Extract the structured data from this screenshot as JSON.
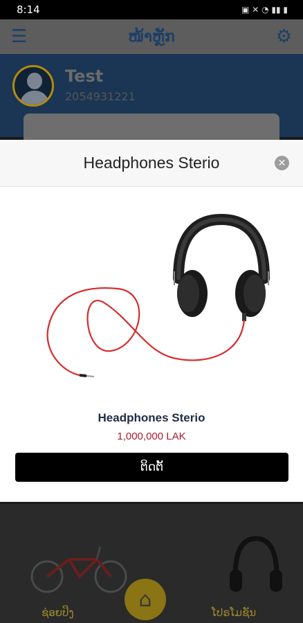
{
  "status_bar": {
    "time": "8:14",
    "icons": "▣ ✕ ◔ ▮▮ ▮"
  },
  "app_bar": {
    "title": "ໜ້າຫຼັກ"
  },
  "profile": {
    "name": "Test",
    "phone": "2054931221"
  },
  "bottom_nav": {
    "left_label": "ຊ່ອຍປິງ",
    "right_label": "ໂປຣໂມຊັນ"
  },
  "modal": {
    "title": "Headphones Sterio",
    "product_name": "Headphones Sterio",
    "price": "1,000,000 LAK",
    "install_label": "ຕິດຕັ້",
    "close_symbol": "✕"
  },
  "colors": {
    "price": "#a51d2d",
    "button": "#000000",
    "appbar_icon": "#1b3f66"
  }
}
